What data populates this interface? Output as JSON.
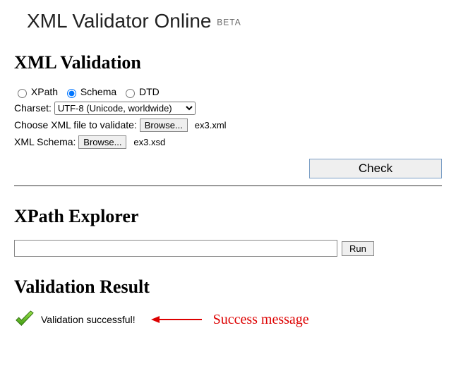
{
  "header": {
    "title": "XML Validator Online",
    "badge": "BETA"
  },
  "validation": {
    "heading": "XML Validation",
    "radios": {
      "xpath": "XPath",
      "schema": "Schema",
      "dtd": "DTD",
      "selected": "schema"
    },
    "charset_label": "Charset:",
    "charset_value": "UTF-8 (Unicode, worldwide)",
    "choose_label": "Choose XML file to validate:",
    "choose_button": "Browse...",
    "choose_filename": "ex3.xml",
    "schema_label": "XML Schema:",
    "schema_button": "Browse...",
    "schema_filename": "ex3.xsd",
    "check_button": "Check"
  },
  "xpath": {
    "heading": "XPath Explorer",
    "input_value": "",
    "run_button": "Run"
  },
  "result": {
    "heading": "Validation Result",
    "message": "Validation successful!",
    "annotation": "Success message"
  }
}
